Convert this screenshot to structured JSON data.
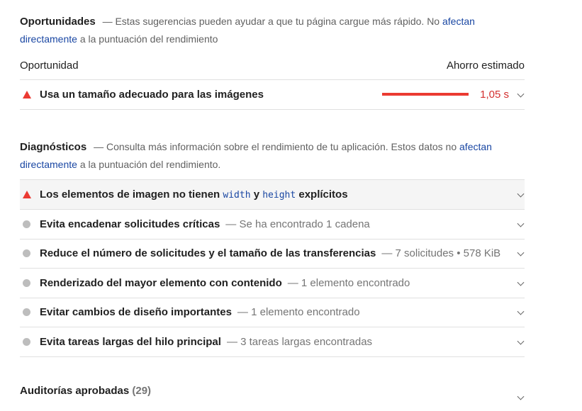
{
  "opportunities": {
    "title": "Oportunidades",
    "description_prefix": "— Estas sugerencias pueden ayudar a que tu página cargue más rápido. No ",
    "description_link": "afectan directamente",
    "description_suffix": " a la puntuación del rendimiento",
    "col_left": "Oportunidad",
    "col_right": "Ahorro estimado",
    "items": [
      {
        "title": "Usa un tamaño adecuado para las imágenes",
        "savings": "1,05 s",
        "savings_fraction": 1.0,
        "status": "fail"
      }
    ]
  },
  "diagnostics": {
    "title": "Diagnósticos",
    "description_prefix": "— Consulta más información sobre el rendimiento de tu aplicación. Estos datos no ",
    "description_link": "afectan directamente",
    "description_suffix": " a la puntuación del rendimiento.",
    "image_item": {
      "title_before": "Los elementos de imagen no tienen ",
      "code1": "width",
      "title_mid": " y ",
      "code2": "height",
      "title_after": " explícitos",
      "status": "fail"
    },
    "items": [
      {
        "title": "Evita encadenar solicitudes críticas",
        "display": "— Se ha encontrado 1 cadena",
        "status": "informative"
      },
      {
        "title": "Reduce el número de solicitudes y el tamaño de las transferencias",
        "display": "— 7 solicitudes • 578 KiB",
        "status": "informative"
      },
      {
        "title": "Renderizado del mayor elemento con contenido",
        "display": "— 1 elemento encontrado",
        "status": "informative"
      },
      {
        "title": "Evitar cambios de diseño importantes",
        "display": "— 1 elemento encontrado",
        "status": "informative"
      },
      {
        "title": "Evita tareas largas del hilo principal",
        "display": "— 3 tareas largas encontradas",
        "status": "informative"
      }
    ]
  },
  "passed": {
    "title": "Auditorías aprobadas",
    "count": "(29)"
  },
  "colors": {
    "fail": "#eb3a32",
    "informative": "#bdbdbd",
    "link": "#1a47a3"
  },
  "icons": {
    "fail": "red-triangle-icon",
    "informative": "gray-circle-icon",
    "expand": "chevron-down-icon"
  }
}
